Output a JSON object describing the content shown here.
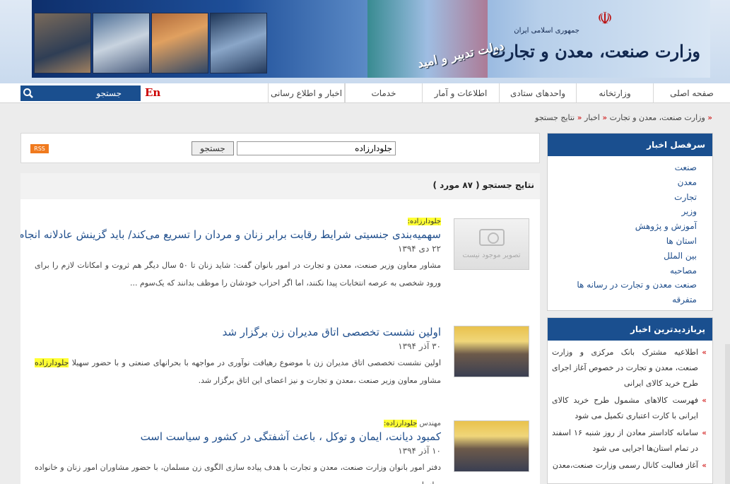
{
  "header": {
    "ministry_sub": "جمهوری اسلامی ایران",
    "ministry_title": "وزارت صنعت، معدن و تجارت",
    "govt_slogan": "دولت تدبیر و امید"
  },
  "nav": {
    "items": [
      "صفحه اصلی",
      "وزارتخانه",
      "واحدهای ستادی",
      "اطلاعات و آمار",
      "خدمات",
      "اخبار و اطلاع رسانی"
    ],
    "lang": "En",
    "search_placeholder": "جستجو"
  },
  "breadcrumb": [
    "وزارت صنعت، معدن و تجارت",
    "اخبار",
    "نتایج جستجو"
  ],
  "search_panel": {
    "query": "جلودارزاده",
    "button": "جستجو",
    "rss": "RSS"
  },
  "results": {
    "heading": "نتایج جستجو ( ۸۷ مورد )",
    "items": [
      {
        "kw_prefix": "",
        "keyword": "جلودارزاده:",
        "title": "سهمیه‌بندی جنسیتی شرایط رقابت برابر زنان و مردان را تسریع می‌کند/ باید گزینش عادلانه انجام شود",
        "date": "۲۲ دی ۱۳۹۴",
        "summary": "مشاور معاون وزیر صنعت، معدن و تجارت در امور بانوان گفت: شاید زنان تا ۵۰ سال دیگر هم ثروت و امکانات لازم را برای ورود شخصی به عرصه انتخابات پیدا نکنند، اما اگر احزاب خودشان را موظف بدانند که یک‌سوم ...",
        "thumb_text": "تصویر موجود نیست"
      },
      {
        "title": "اولین نشست تخصصی اتاق مدیران زن برگزار شد",
        "date": "۳۰ آذر ۱۳۹۴",
        "summary_before": "اولین نشست تخصصی اتاق مدیران زن با موضوع رهیافت نوآوری در مواجهه با بحرانهای صنعتی و با حضور سهیلا",
        "summary_keyword": "جلودارزاده",
        "summary_after": "مشاور معاون وزیر صنعت ،معدن و تجارت و نیز اعضای این اتاق برگزار شد."
      },
      {
        "kw_prefix": "مهندس",
        "keyword": "جلودارزاده:",
        "title": "کمبود دیانت، ایمان و توکل ، باعث آشفتگی در کشور و سیاست است",
        "date": "۱۰ آذر ۱۳۹۴",
        "summary": "دفتر امور بانوان وزارت صنعت، معدن و تجارت با هدف پیاده سازی الگوی زن مسلمان، با حضور مشاوران امور زنان و خانواده سازمان"
      }
    ]
  },
  "sidebar": {
    "categories_title": "سرفصل اخبار",
    "categories": [
      "صنعت",
      "معدن",
      "تجارت",
      "وزیر",
      "آموزش و پژوهش",
      "استان ها",
      "بین الملل",
      "مصاحبه",
      "صنعت معدن و تجارت در رسانه ها",
      "متفرقه"
    ],
    "popular_title": "پربازدیدترین اخبار",
    "popular": [
      "اطلاعیه مشترک بانک مرکزی و وزارت صنعت، معدن و تجارت در خصوص آغاز اجرای طرح خرید کالای ایرانی",
      "فهرست کالاهای مشمول طرح خرید کالای ایرانی با کارت اعتباری تکمیل می شود",
      "سامانه کاداستر معادن از روز شنبه ۱۶ اسفند در تمام استان‌ها اجرایی می شود",
      "آغاز فعالیت کانال رسمی وزارت صنعت،معدن"
    ]
  }
}
